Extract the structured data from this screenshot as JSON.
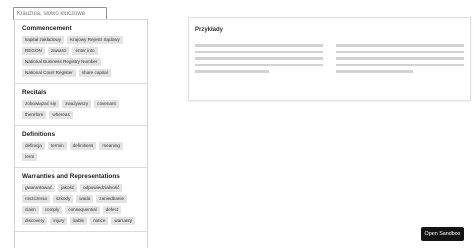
{
  "search": {
    "placeholder": "Klauzula, słowo kluczowe",
    "value": ""
  },
  "sections": [
    {
      "title": "Commencement",
      "chips": [
        "kapitał zakładowy",
        "Krajowy Rejestr Sądowy",
        "REGON",
        "zawarci",
        "enter into",
        "National Business Registry Number",
        "National Court Register",
        "share capital"
      ]
    },
    {
      "title": "Recitals",
      "chips": [
        "zobowiązać się",
        "zważywszy",
        "covenant",
        "therefore",
        "whereas"
      ]
    },
    {
      "title": "Definitions",
      "chips": [
        "definicja",
        "termin",
        "definitions",
        "meaning",
        "term"
      ]
    },
    {
      "title": "Warranties and Representations",
      "chips": [
        "gwarantować",
        "jakość",
        "odpowiedzialność",
        "roszczenia",
        "szkody",
        "wada",
        "zaniedbanie",
        "claim",
        "comply",
        "consequential",
        "defect",
        "discovery",
        "injury",
        "liable",
        "notice",
        "warranty"
      ]
    }
  ],
  "examples": {
    "title": "Przykłady"
  },
  "sandbox_button": {
    "label": "Open Sandbox"
  }
}
